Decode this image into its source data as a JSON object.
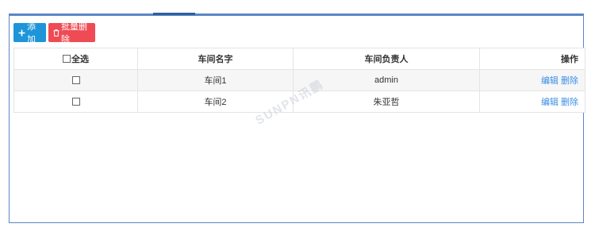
{
  "toolbar": {
    "add_label": "添加",
    "batch_delete_label": "批量删除"
  },
  "table": {
    "headers": {
      "select_all": "全选",
      "workshop_name": "车间名字",
      "workshop_manager": "车间负责人",
      "actions": "操作"
    },
    "rows": [
      {
        "name": "车间1",
        "manager": "admin",
        "edit": "编辑",
        "delete": "删除"
      },
      {
        "name": "车间2",
        "manager": "朱亚哲",
        "edit": "编辑",
        "delete": "删除"
      }
    ]
  },
  "watermark": "SUNPN讯鹏",
  "colors": {
    "add_button": "#1e95d8",
    "delete_button": "#ef4b55",
    "link": "#3a8ee6",
    "panel_border": "#5b86c4"
  }
}
